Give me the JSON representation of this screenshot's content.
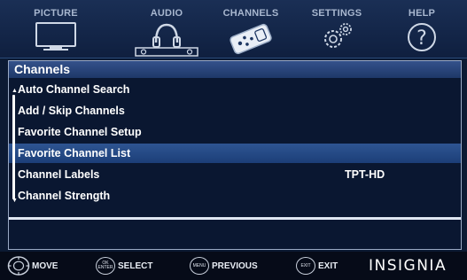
{
  "tabs": [
    {
      "label": "PICTURE",
      "icon": "tv-icon",
      "active": false
    },
    {
      "label": "AUDIO",
      "icon": "headphones-icon",
      "active": false
    },
    {
      "label": "CHANNELS",
      "icon": "remote-icon",
      "active": true
    },
    {
      "label": "SETTINGS",
      "icon": "gears-icon",
      "active": false
    },
    {
      "label": "HELP",
      "icon": "help-icon",
      "active": false
    }
  ],
  "panel": {
    "title": "Channels",
    "items": [
      {
        "label": "Auto Channel Search",
        "value": ""
      },
      {
        "label": "Add / Skip Channels",
        "value": ""
      },
      {
        "label": "Favorite Channel Setup",
        "value": ""
      },
      {
        "label": "Favorite Channel List",
        "value": "",
        "selected": true
      },
      {
        "label": "Channel Labels",
        "value": "TPT-HD"
      },
      {
        "label": "Channel Strength",
        "value": ""
      }
    ]
  },
  "footer": {
    "move": {
      "button": "",
      "label": "MOVE"
    },
    "select": {
      "button_top": "OK",
      "button_bottom": "ENTER",
      "label": "SELECT"
    },
    "previous": {
      "button": "MENU",
      "label": "PREVIOUS"
    },
    "exit": {
      "button": "EXIT",
      "label": "EXIT"
    },
    "brand": "INSIGNIA"
  },
  "colors": {
    "background": "#0c1a33",
    "highlight": "#2e5592",
    "tab_inactive": "#a8b7cf",
    "text": "#ffffff"
  }
}
